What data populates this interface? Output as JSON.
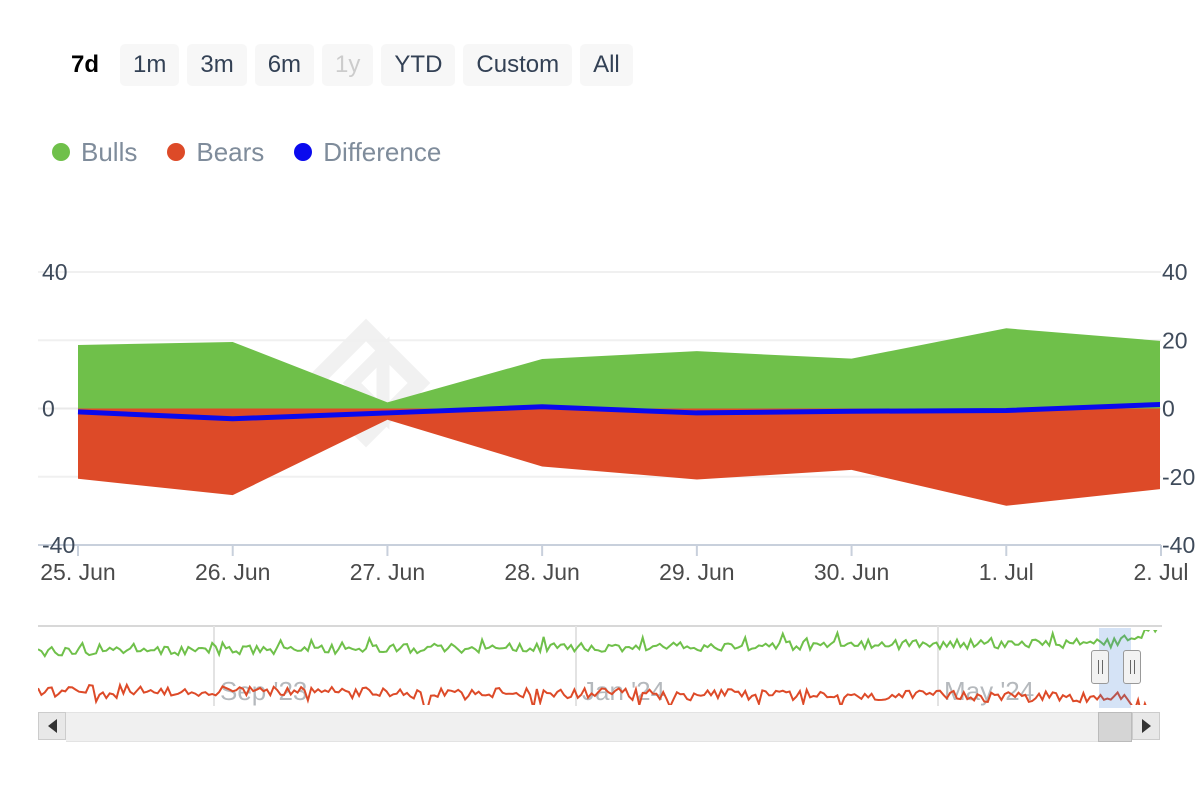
{
  "range_selector": {
    "buttons": [
      {
        "label": "7d",
        "state": "selected"
      },
      {
        "label": "1m",
        "state": "normal"
      },
      {
        "label": "3m",
        "state": "normal"
      },
      {
        "label": "6m",
        "state": "normal"
      },
      {
        "label": "1y",
        "state": "disabled"
      },
      {
        "label": "YTD",
        "state": "normal"
      },
      {
        "label": "Custom",
        "state": "normal"
      },
      {
        "label": "All",
        "state": "normal"
      }
    ]
  },
  "legend": {
    "items": [
      {
        "label": "Bulls",
        "color": "#6fc04a",
        "icon": "legend-dot-icon"
      },
      {
        "label": "Bears",
        "color": "#dd4a28",
        "icon": "legend-dot-icon"
      },
      {
        "label": "Difference",
        "color": "#0a0aee",
        "icon": "legend-dot-icon"
      }
    ]
  },
  "watermark": {
    "name": "diamond-logo-watermark",
    "color": "#f2f2f2"
  },
  "navigator": {
    "tick_labels": [
      "Sep '23",
      "Jan '24",
      "May '24"
    ],
    "handles": [
      "nav-handle-left",
      "nav-handle-right"
    ],
    "scrollbar": {
      "left_arrow": "◀",
      "right_arrow": "▶"
    }
  },
  "chart_data": {
    "type": "area",
    "title": "",
    "xlabel": "",
    "ylabel": "",
    "ylim": [
      -40,
      40
    ],
    "y_ticks": [
      40,
      20,
      0,
      -20,
      -40
    ],
    "y_ticks_left_shown": [
      40,
      0,
      -40
    ],
    "y_ticks_right_shown": [
      40,
      20,
      0,
      -20,
      -40
    ],
    "grid": true,
    "legend_position": "top-left",
    "categories": [
      "25. Jun",
      "26. Jun",
      "27. Jun",
      "28. Jun",
      "29. Jun",
      "30. Jun",
      "1. Jul",
      "2. Jul"
    ],
    "series": [
      {
        "name": "Bulls",
        "type": "area",
        "color": "#6fc04a",
        "values": [
          18.6,
          19.5,
          1.8,
          14.5,
          16.8,
          14.6,
          23.5,
          19.8
        ]
      },
      {
        "name": "Bears",
        "type": "area",
        "color": "#dd4a28",
        "values": [
          -20.6,
          -25.4,
          -3.3,
          -17.0,
          -20.8,
          -18.0,
          -28.5,
          -23.6
        ]
      },
      {
        "name": "Difference",
        "type": "line",
        "color": "#0a0aee",
        "values": [
          -1.0,
          -3.0,
          -1.3,
          0.5,
          -1.3,
          -0.8,
          -0.6,
          1.2
        ]
      }
    ],
    "navigator_series": [
      {
        "name": "Bulls",
        "color": "#6fc04a"
      },
      {
        "name": "Bears",
        "color": "#dd4a28"
      }
    ]
  }
}
